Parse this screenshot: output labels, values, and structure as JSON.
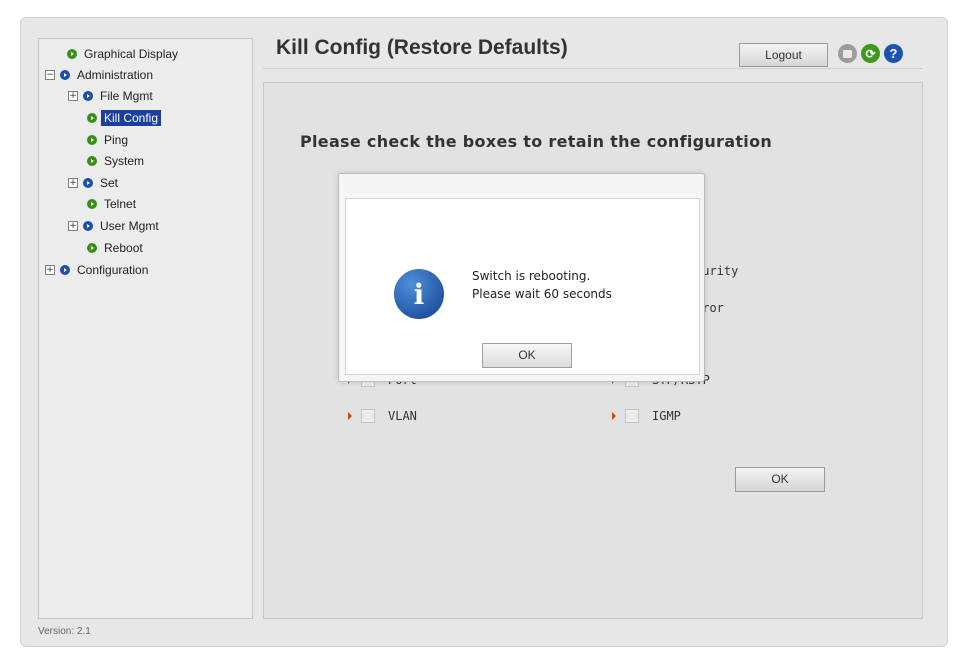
{
  "sidebar": {
    "items": [
      {
        "label": "Graphical Display"
      },
      {
        "label": "Administration",
        "expander": "−"
      },
      {
        "label": "File Mgmt",
        "expander": "+"
      },
      {
        "label": "Kill Config"
      },
      {
        "label": "Ping"
      },
      {
        "label": "System"
      },
      {
        "label": "Set",
        "expander": "+"
      },
      {
        "label": "Telnet"
      },
      {
        "label": "User Mgmt",
        "expander": "+"
      },
      {
        "label": "Reboot"
      },
      {
        "label": "Configuration",
        "expander": "+"
      }
    ]
  },
  "header": {
    "title": "Kill Config (Restore Defaults)",
    "logout_label": "Logout",
    "refresh_glyph": "⟳",
    "help_glyph": "?"
  },
  "main": {
    "instruction": "Please check the boxes to retain the configuration",
    "options": [
      {
        "label": "Port",
        "visible_text": "Port",
        "checked": false
      },
      {
        "label": "STP/RSTP",
        "visible_text": "STP/RSTP",
        "checked": false
      },
      {
        "label": "VLAN",
        "visible_text": "VLAN",
        "checked": false
      },
      {
        "label": "IGMP",
        "visible_text": "IGMP",
        "checked": false
      },
      {
        "visible_text": "curity"
      },
      {
        "visible_text": "rror"
      }
    ],
    "ok_label": "OK"
  },
  "dialog": {
    "icon_glyph": "i",
    "line1": "Switch is rebooting.",
    "line2": "Please wait 60 seconds",
    "ok_label": "OK"
  },
  "footer": {
    "version": "Version: 2.1"
  },
  "colors": {
    "selected_bg": "#1a3f9c",
    "tree_green": "#3a8f18",
    "tree_blue": "#1b4fa8",
    "arrow": "#c84a1a"
  }
}
